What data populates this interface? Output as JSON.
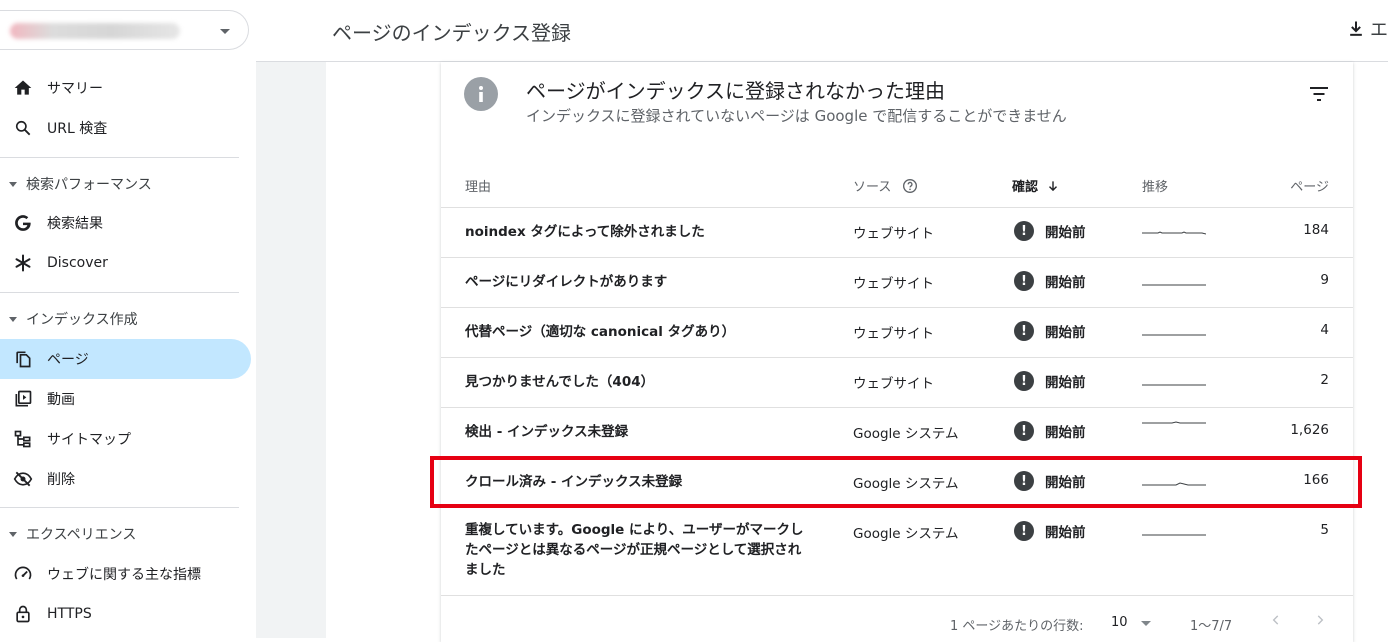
{
  "sidebar": {
    "property_selector": {
      "value": ""
    },
    "items": [
      {
        "label": "サマリー",
        "icon": "home-icon"
      },
      {
        "label": "URL 検査",
        "icon": "search-icon"
      }
    ],
    "sections": [
      {
        "label": "検索パフォーマンス",
        "items": [
          {
            "label": "検索結果",
            "icon": "google-g-icon"
          },
          {
            "label": "Discover",
            "icon": "asterisk-icon"
          }
        ]
      },
      {
        "label": "インデックス作成",
        "items": [
          {
            "label": "ページ",
            "icon": "pages-icon",
            "active": true
          },
          {
            "label": "動画",
            "icon": "video-icon"
          },
          {
            "label": "サイトマップ",
            "icon": "sitemap-icon"
          },
          {
            "label": "削除",
            "icon": "eye-off-icon"
          }
        ]
      },
      {
        "label": "エクスペリエンス",
        "items": [
          {
            "label": "ウェブに関する主な指標",
            "icon": "speed-icon"
          },
          {
            "label": "HTTPS",
            "icon": "lock-icon"
          }
        ]
      }
    ]
  },
  "header": {
    "title": "ページのインデックス登録",
    "export_label": "エ"
  },
  "card": {
    "title": "ページがインデックスに登録されなかった理由",
    "subtitle": "インデックスに登録されていないページは Google で配信することができません",
    "columns": {
      "reason": "理由",
      "source": "ソース",
      "validation": "確認",
      "trend": "推移",
      "pages": "ページ"
    },
    "rows": [
      {
        "reason": "noindex タグによって除外されました",
        "source": "ウェブサイト",
        "status": "開始前",
        "pages": "184"
      },
      {
        "reason": "ページにリダイレクトがあります",
        "source": "ウェブサイト",
        "status": "開始前",
        "pages": "9"
      },
      {
        "reason": "代替ページ（適切な canonical タグあり）",
        "source": "ウェブサイト",
        "status": "開始前",
        "pages": "4"
      },
      {
        "reason": "見つかりませんでした（404）",
        "source": "ウェブサイト",
        "status": "開始前",
        "pages": "2"
      },
      {
        "reason": "検出 - インデックス未登録",
        "source": "Google システム",
        "status": "開始前",
        "pages": "1,626"
      },
      {
        "reason": "クロール済み - インデックス未登録",
        "source": "Google システム",
        "status": "開始前",
        "pages": "166",
        "highlighted": true
      },
      {
        "reason": "重複しています。Google により、ユーザーがマークしたページとは異なるページが正規ページとして選択されました",
        "source": "Google システム",
        "status": "開始前",
        "pages": "5"
      }
    ],
    "footer": {
      "rows_per_page_label": "1 ページあたりの行数:",
      "rows_per_page_value": "10",
      "range": "1〜7/7"
    }
  },
  "colors": {
    "active_nav_bg": "#c2e7ff",
    "highlight_border": "#e60012",
    "status_icon": "#3c4043"
  }
}
